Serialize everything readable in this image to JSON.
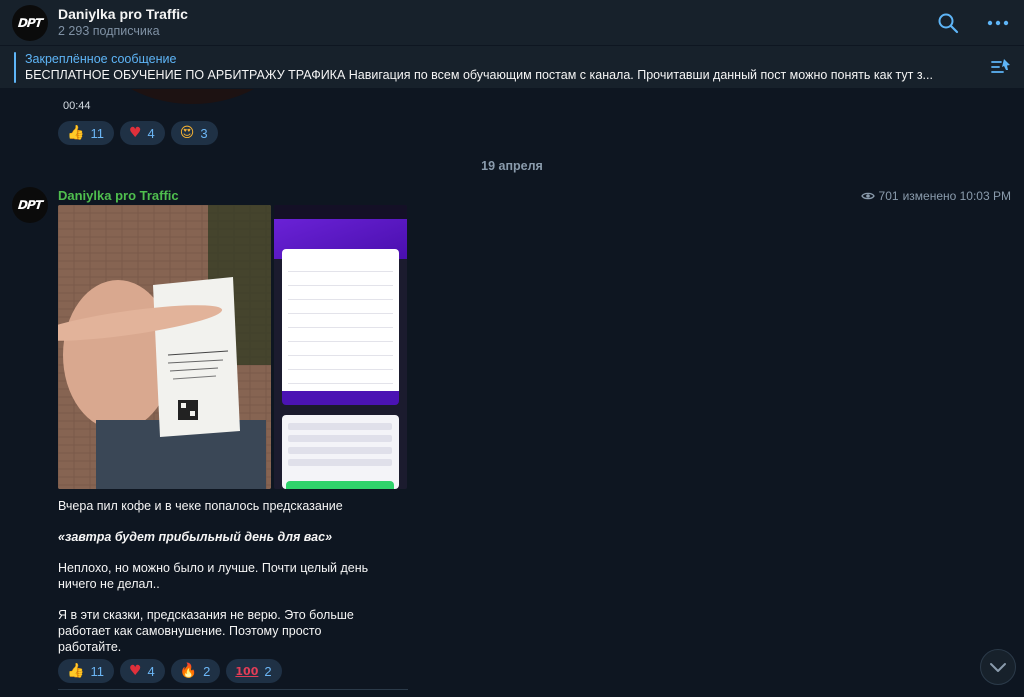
{
  "header": {
    "channel_name": "Daniylka pro Traffic",
    "subscribers": "2 293 подписчика",
    "search_icon": "search-icon",
    "more_icon": "more-icon"
  },
  "pinned": {
    "label": "Закреплённое сообщение",
    "text": "БЕСПЛАТНОЕ ОБУЧЕНИЕ ПО АРБИТРАЖУ ТРАФИКА  Навигация по всем обучающим постам с канала. Прочитавши данный пост можно понять как тут з...",
    "icon": "pinned-list-icon"
  },
  "previous_message": {
    "time": "00:44",
    "reactions": [
      {
        "emoji": "like",
        "count": "11"
      },
      {
        "emoji": "heart",
        "count": "4"
      },
      {
        "emoji": "heart-eyes",
        "count": "3"
      }
    ]
  },
  "date_separator": "19 апреля",
  "message": {
    "author": "Daniylka pro Traffic",
    "views": "701",
    "edited_time": "изменено 10:03 PM",
    "text_1": "Вчера пил кофе и в чеке попалось предсказание",
    "text_2": "«завтра будет прибыльный день для вас»",
    "text_3": "Неплохо, но можно было и лучше. Почти целый день ничего не делал..",
    "text_4": "Я в эти сказки, предсказания не верю. Это больше работает как самовнушение. Поэтому просто работайте.",
    "reactions": [
      {
        "emoji": "like",
        "count": "11"
      },
      {
        "emoji": "heart",
        "count": "4"
      },
      {
        "emoji": "fire",
        "count": "2"
      },
      {
        "emoji": "hundred",
        "count": "2"
      }
    ]
  },
  "colors": {
    "background": "#0e1621",
    "panel": "#17212b",
    "accent": "#5eb5f7",
    "author_green": "#4fbe4e",
    "reaction_bg": "#1f3145"
  }
}
